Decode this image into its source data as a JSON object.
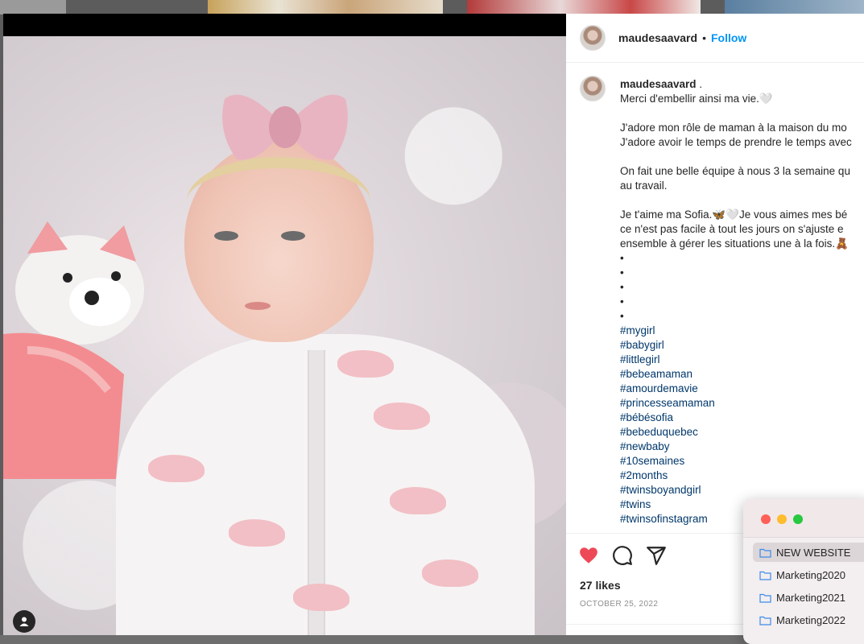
{
  "header": {
    "username": "maudesaavard",
    "separator": "•",
    "follow_label": "Follow"
  },
  "caption": {
    "username": "maudesaavard",
    "username_suffix": ".",
    "lines": [
      "Merci d'embellir ainsi ma vie.🤍",
      "",
      "J'adore mon rôle de maman à la maison du mo",
      "J'adore avoir le temps de prendre le temps avec",
      "",
      "On fait une belle équipe à nous 3 la semaine qu",
      "au travail.",
      "",
      "Je t'aime ma Sofia.🦋🤍Je vous aimes mes bé",
      "ce n'est pas facile à tout les jours on s'ajuste e",
      "ensemble à gérer les situations une à la fois.🧸",
      "•",
      "•",
      "•",
      "•",
      "•"
    ],
    "hashtags": [
      "#mygirl",
      "#babygirl",
      "#littlegirl",
      "#bebeamaman",
      "#amourdemavie",
      "#princesseamaman",
      "#bébésofia",
      "#bebeduquebec",
      "#newbaby",
      "#10semaines",
      "#2months",
      "#twinsboyandgirl",
      "#twins",
      "#twinsofinstagram"
    ]
  },
  "actions": {
    "like_icon": "heart-filled-icon",
    "comment_icon": "comment-bubble-icon",
    "share_icon": "paper-plane-icon",
    "like_color": "#ed4956",
    "likes_text": "27 likes",
    "date_text": "OCTOBER 25, 2022"
  },
  "finder": {
    "items": [
      {
        "label": "NEW WEBSITE",
        "selected": true
      },
      {
        "label": "Marketing2020",
        "selected": false
      },
      {
        "label": "Marketing2021",
        "selected": false
      },
      {
        "label": "Marketing2022",
        "selected": false
      }
    ]
  },
  "colors": {
    "link": "#0095f6",
    "hashtag": "#00376b",
    "text": "#262626",
    "muted": "#8e8e8e"
  }
}
